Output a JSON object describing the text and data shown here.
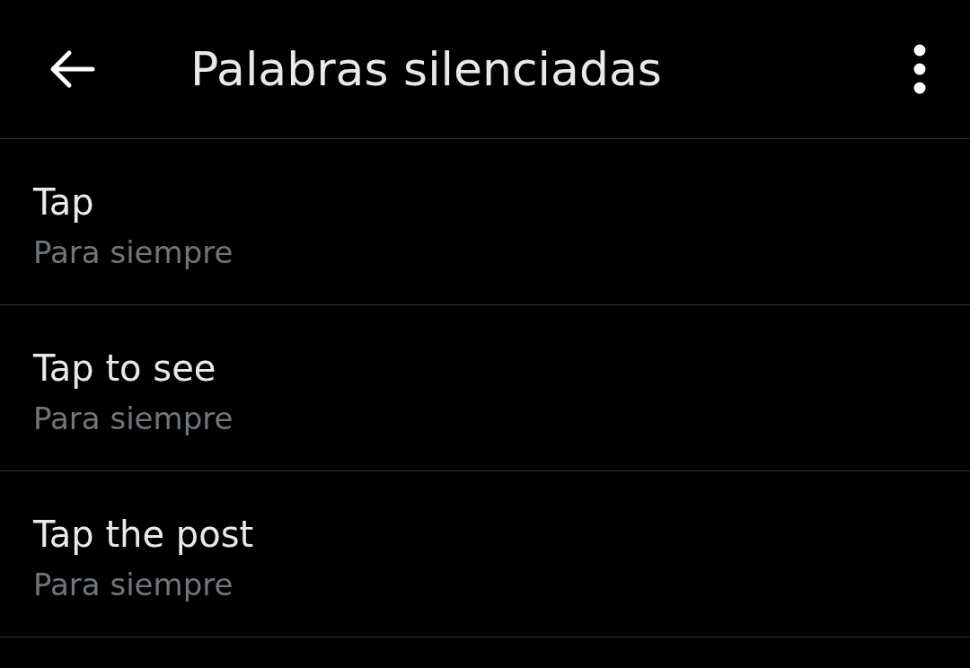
{
  "header": {
    "title": "Palabras silenciadas"
  },
  "muted_words": [
    {
      "word": "Tap",
      "duration": "Para siempre"
    },
    {
      "word": "Tap to see",
      "duration": "Para siempre"
    },
    {
      "word": "Tap the post",
      "duration": "Para siempre"
    }
  ]
}
